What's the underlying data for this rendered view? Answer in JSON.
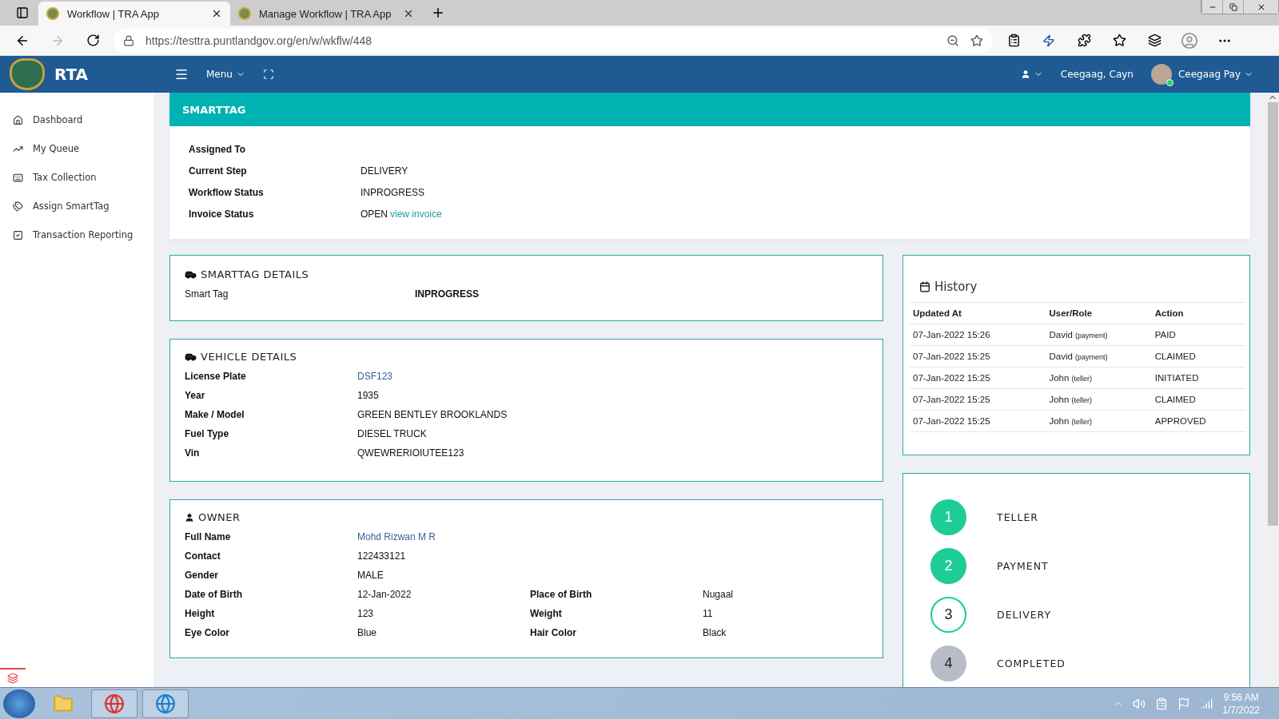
{
  "browser": {
    "tabs": [
      {
        "title": "Workflow | TRA App",
        "selected": true
      },
      {
        "title": "Manage Workflow | TRA App",
        "selected": false
      }
    ],
    "url": "https://testtra.puntlandgov.org/en/w/wkflw/448"
  },
  "header": {
    "brand": "RTA",
    "menu": "Menu",
    "user_name": "Ceegaag, Cayn",
    "account": "Ceegaag Pay"
  },
  "sidebar": {
    "items": [
      {
        "label": "Dashboard",
        "kind": "home"
      },
      {
        "label": "My Queue",
        "kind": "trend"
      },
      {
        "label": "Tax Collection",
        "kind": "table"
      },
      {
        "label": "Assign SmartTag",
        "kind": "tags"
      },
      {
        "label": "Transaction Reporting",
        "kind": "check"
      }
    ]
  },
  "workflow": {
    "title": "SMARTTAG",
    "fields": [
      {
        "label": "Assigned To"
      },
      {
        "label": "Current Step",
        "value": "DELIVERY"
      },
      {
        "label": "Workflow Status",
        "value": "INPROGRESS"
      },
      {
        "label": "Invoice Status",
        "value": "OPEN",
        "link": "view invoice"
      }
    ]
  },
  "smarttag_details": {
    "title": "SMARTTAG DETAILS",
    "fields": [
      {
        "label": "Smart Tag",
        "value": "INPROGRESS"
      }
    ]
  },
  "vehicle_details": {
    "title": "VEHICLE DETAILS",
    "fields": [
      {
        "label": "License Plate",
        "value": "DSF123",
        "link": true
      },
      {
        "label": "Year",
        "value": "1935",
        "link": false
      },
      {
        "label": "Make / Model",
        "value": "GREEN BENTLEY BROOKLANDS",
        "link": false
      },
      {
        "label": "Fuel Type",
        "value": "DIESEL TRUCK",
        "link": false
      },
      {
        "label": "Vin",
        "value": "QWEWRERIOIUTEE123",
        "link": false
      }
    ]
  },
  "owner": {
    "title": "OWNER",
    "rows": [
      [
        {
          "label": "Full Name",
          "value": "Mohd Rizwan M R",
          "link": true
        }
      ],
      [
        {
          "label": "Contact",
          "value": "122433121",
          "link": false
        }
      ],
      [
        {
          "label": "Gender",
          "value": "MALE",
          "link": false
        }
      ],
      [
        {
          "label": "Date of Birth",
          "value": "12-Jan-2022",
          "link": false
        },
        {
          "label": "Place of Birth",
          "value": "Nugaal",
          "link": false
        }
      ],
      [
        {
          "label": "Height",
          "value": "123",
          "link": false
        },
        {
          "label": "Weight",
          "value": "11",
          "link": false
        }
      ],
      [
        {
          "label": "Eye Color",
          "value": "Blue",
          "link": false
        },
        {
          "label": "Hair Color",
          "value": "Black",
          "link": false
        }
      ]
    ]
  },
  "history": {
    "title": "History",
    "columns": [
      "Updated At",
      "User/Role",
      "Action"
    ],
    "rows": [
      {
        "updated_at": "07-Jan-2022 15:26",
        "user": "David",
        "role": "(payment)",
        "action": "PAID"
      },
      {
        "updated_at": "07-Jan-2022 15:25",
        "user": "David",
        "role": "(payment)",
        "action": "CLAIMED"
      },
      {
        "updated_at": "07-Jan-2022 15:25",
        "user": "John",
        "role": "(teller)",
        "action": "INITIATED"
      },
      {
        "updated_at": "07-Jan-2022 15:25",
        "user": "John",
        "role": "(teller)",
        "action": "CLAIMED"
      },
      {
        "updated_at": "07-Jan-2022 15:25",
        "user": "John",
        "role": "(teller)",
        "action": "APPROVED"
      }
    ]
  },
  "steps": [
    {
      "number": "1",
      "label": "TELLER",
      "kind": "done"
    },
    {
      "number": "2",
      "label": "PAYMENT",
      "kind": "done"
    },
    {
      "number": "3",
      "label": "DELIVERY",
      "kind": "current"
    },
    {
      "number": "4",
      "label": "COMPLETED",
      "kind": "pending"
    }
  ],
  "taskbar": {
    "time": "9:56 AM",
    "date": "1/7/2022"
  }
}
